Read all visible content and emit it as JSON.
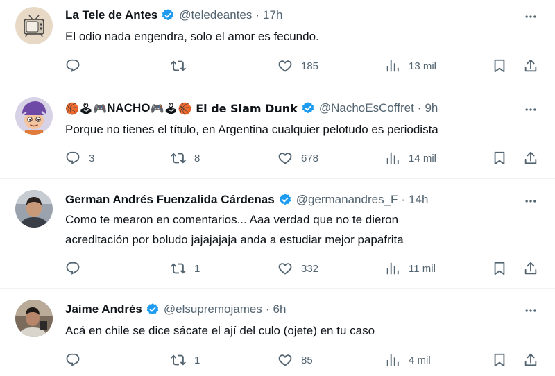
{
  "icons": {
    "reply": "reply-icon",
    "retweet": "retweet-icon",
    "like": "heart-icon",
    "views": "views-chart-icon",
    "bookmark": "bookmark-icon",
    "share": "share-icon",
    "more": "more-icon",
    "verified": "verified-badge-icon"
  },
  "colors": {
    "verified": "#1d9bf0",
    "secondary_text": "#536471",
    "primary_text": "#0f1419",
    "divider": "#eff3f4"
  },
  "tweets": [
    {
      "name": "La Tele de Antes",
      "handle": "@teledeantes",
      "separator": "·",
      "time": "17h",
      "text": "El odio nada engendra, solo el amor es fecundo.",
      "replies": "",
      "retweets": "",
      "likes": "185",
      "views": "13 mil"
    },
    {
      "name_prefix": "🏀🕹🎮",
      "name": "NACHO",
      "name_suffix": "🎮🕹🏀 El de Slam Dunk",
      "handle": "@NachoEsCoffret",
      "separator": "·",
      "time": "9h",
      "text": "Porque no tienes el título, en Argentina cualquier pelotudo es periodista",
      "replies": "3",
      "retweets": "8",
      "likes": "678",
      "views": "14 mil"
    },
    {
      "name": "German Andrés Fuenzalida Cárdenas",
      "handle": "@germanandres_F",
      "separator": "·",
      "time": "14h",
      "text_line1": "Como te mearon en comentarios... Aaa verdad que no te dieron",
      "text_line2": "acreditación por boludo jajajajaja anda a estudiar mejor papafrita",
      "replies": "",
      "retweets": "1",
      "likes": "332",
      "views": "11 mil"
    },
    {
      "name": "Jaime Andrés",
      "handle": "@elsupremojames",
      "separator": "·",
      "time": "6h",
      "text": "Acá en chile se dice sácate el ají del culo (ojete) en tu caso",
      "replies": "",
      "retweets": "1",
      "likes": "85",
      "views": "4 mil"
    }
  ]
}
